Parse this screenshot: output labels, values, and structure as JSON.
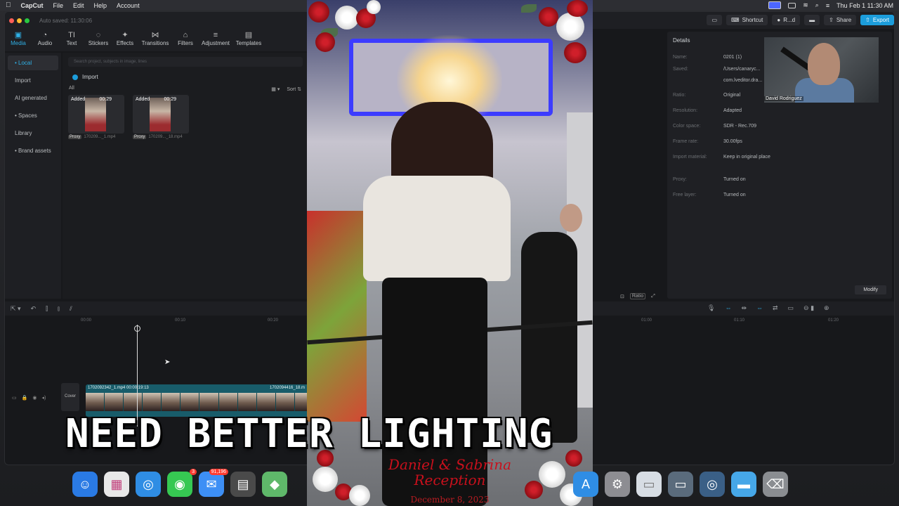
{
  "menubar": {
    "app_name": "CapCut",
    "menus": [
      "File",
      "Edit",
      "Help",
      "Account"
    ],
    "datetime": "Thu Feb 1  11:30 AM"
  },
  "window": {
    "autosave": "Auto saved: 11:30:06",
    "shortcut_label": "Shortcut",
    "user_label": "R...d",
    "share_label": "Share",
    "export_label": "Export"
  },
  "tabs": [
    {
      "label": "Media",
      "icon": "▣"
    },
    {
      "label": "Audio",
      "icon": "◔"
    },
    {
      "label": "Text",
      "icon": "TI"
    },
    {
      "label": "Stickers",
      "icon": "◌"
    },
    {
      "label": "Effects",
      "icon": "✦"
    },
    {
      "label": "Transitions",
      "icon": "⋈"
    },
    {
      "label": "Filters",
      "icon": "⌂"
    },
    {
      "label": "Adjustment",
      "icon": "≡"
    },
    {
      "label": "Templates",
      "icon": "▤"
    }
  ],
  "leftnav": [
    "• Local",
    "Import",
    "AI generated",
    "• Spaces",
    "Library",
    "• Brand assets"
  ],
  "media": {
    "search_placeholder": "Search project, subjects in image, lines",
    "import_label": "Import",
    "sort_label": "Sort",
    "all_label": "All",
    "clips": [
      {
        "added": "Added",
        "duration": "00:29",
        "proxy": "Proxy",
        "name": "170209..._1.mp4"
      },
      {
        "added": "Added",
        "duration": "00:29",
        "proxy": "Proxy",
        "name": "170209..._18.mp4"
      }
    ]
  },
  "details": {
    "title": "Details",
    "rows": [
      {
        "label": "Name:",
        "value": "0201 (1)"
      },
      {
        "label": "Saved:",
        "value": "/Users/canaryc..."
      },
      {
        "label": "",
        "value": "com.lveditor.dra..."
      },
      {
        "label": "Ratio:",
        "value": "Original"
      },
      {
        "label": "Resolution:",
        "value": "Adapted"
      },
      {
        "label": "Color space:",
        "value": "SDR - Rec.709"
      },
      {
        "label": "Frame rate:",
        "value": "30.00fps"
      },
      {
        "label": "Import material:",
        "value": "Keep in original place"
      },
      {
        "label": "Proxy:",
        "value": "Turned on"
      },
      {
        "label": "Free layer:",
        "value": "Turned on"
      }
    ],
    "modify_label": "Modify"
  },
  "webcam": {
    "name": "David Rodriguez"
  },
  "player": {
    "ratio_label": "Ratio"
  },
  "timeline": {
    "ruler": [
      "00:00",
      "00:10",
      "00:20",
      "01:00",
      "01:10",
      "01:20"
    ],
    "clip_label_1": "1702092342_1.mp4   00:00:19:13",
    "clip_label_2": "1702094416_18.m",
    "cover_label": "Cover"
  },
  "video": {
    "script_line1": "Daniel & Sabrina",
    "script_line2": "Reception",
    "date": "December 8, 2023"
  },
  "caption": "NEED BETTER LIGHTING",
  "dock": [
    {
      "name": "finder-icon",
      "color": "#2a7ae4",
      "glyph": "☺"
    },
    {
      "name": "launchpad-icon",
      "color": "#e8e8e8",
      "glyph": "▦"
    },
    {
      "name": "safari-icon",
      "color": "#2f8de4",
      "glyph": "◎"
    },
    {
      "name": "messages-icon",
      "color": "#36c852",
      "glyph": "◉",
      "badge": "3"
    },
    {
      "name": "mail-icon",
      "color": "#3d8ff5",
      "glyph": "✉",
      "badge": "91,196"
    },
    {
      "name": "calculator-icon",
      "color": "#4a4a4a",
      "glyph": "▤"
    },
    {
      "name": "maps-icon",
      "color": "#5fb86a",
      "glyph": "◆"
    }
  ],
  "dock_right": [
    {
      "name": "appstore-icon",
      "color": "#2f8de4",
      "glyph": "A"
    },
    {
      "name": "settings-icon",
      "color": "#8d8d92",
      "glyph": "⚙"
    },
    {
      "name": "preview-icon",
      "color": "#d7dde4",
      "glyph": "▭"
    },
    {
      "name": "screenshot-icon",
      "color": "#5a6b7c",
      "glyph": "▭"
    },
    {
      "name": "quicktime-icon",
      "color": "#3a5f86",
      "glyph": "◎"
    },
    {
      "name": "folder-icon",
      "color": "#46a7e8",
      "glyph": "▬"
    },
    {
      "name": "trash-icon",
      "color": "#8a8d91",
      "glyph": "⌫"
    }
  ]
}
